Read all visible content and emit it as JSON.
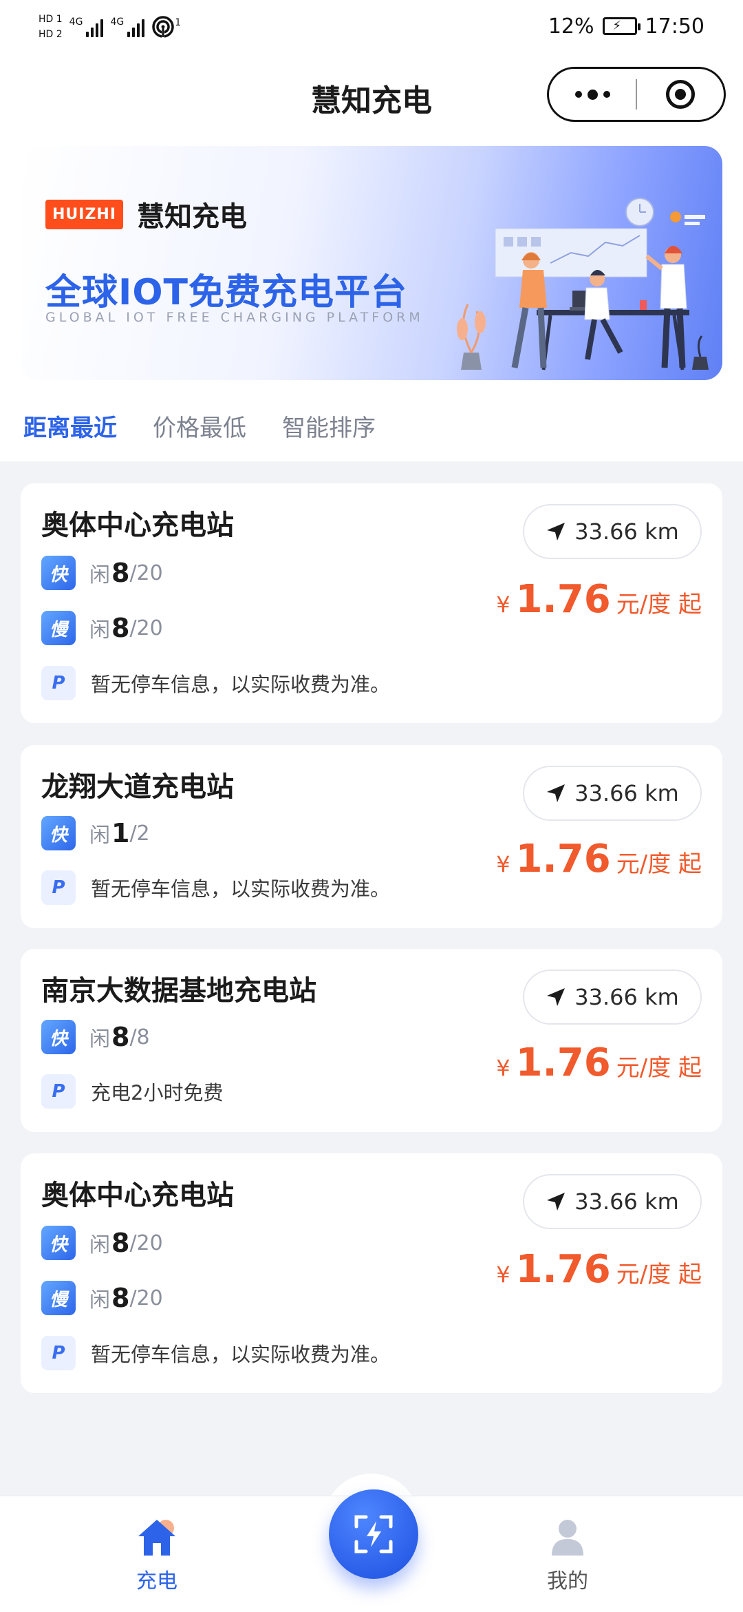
{
  "status_bar": {
    "hd1": "HD 1",
    "hd2": "HD 2",
    "sig1_label": "4G",
    "sig2_label": "4G",
    "hotspot_label": "1",
    "battery": "12%",
    "time": "17:50"
  },
  "nav": {
    "title": "慧知充电"
  },
  "banner": {
    "logo": "HUIZHI",
    "brand": "慧知充电",
    "slogan": "全球IOT免费充电平台",
    "slogan_en": "GLOBAL IOT FREE CHARGING PLATFORM"
  },
  "tabs": [
    "距离最近",
    "价格最低",
    "智能排序"
  ],
  "labels": {
    "fast": "快",
    "slow": "慢",
    "parking": "P",
    "idle": "闲",
    "yen": "¥",
    "unit": "元/度 起"
  },
  "stations": [
    {
      "name": "奥体中心充电站",
      "distance": "33.66 km",
      "fast_free": "8",
      "fast_total": "/20",
      "slow_free": "8",
      "slow_total": "/20",
      "parking": "暂无停车信息，以实际收费为准。",
      "price": "1.76"
    },
    {
      "name": "龙翔大道充电站",
      "distance": "33.66 km",
      "fast_free": "1",
      "fast_total": "/2",
      "parking": "暂无停车信息，以实际收费为准。",
      "price": "1.76"
    },
    {
      "name": "南京大数据基地充电站",
      "distance": "33.66 km",
      "fast_free": "8",
      "fast_total": "/8",
      "parking": "充电2小时免费",
      "price": "1.76"
    },
    {
      "name": "奥体中心充电站",
      "distance": "33.66 km",
      "fast_free": "8",
      "fast_total": "/20",
      "slow_free": "8",
      "slow_total": "/20",
      "parking": "暂无停车信息，以实际收费为准。",
      "price": "1.76"
    }
  ],
  "bottom_nav": {
    "charge": "充电",
    "mine": "我的"
  },
  "colors": {
    "accent": "#2c63e8",
    "price": "#f05a2c",
    "logo": "#ff4d1c"
  },
  "icons": [
    "location-arrow-icon",
    "home-icon",
    "scan-charge-icon",
    "user-icon"
  ]
}
